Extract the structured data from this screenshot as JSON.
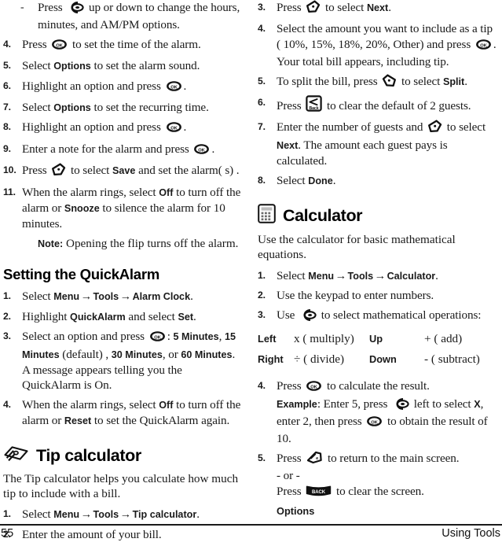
{
  "page": {
    "folio": "55",
    "running_head": "Using Tools"
  },
  "left_column": {
    "alarm_steps": [
      {
        "marker": "-",
        "type": "dash",
        "parts": [
          {
            "t": "Press "
          },
          {
            "icon": "nav-key-icon"
          },
          {
            "t": " up or down to change the hours, minutes, and AM/PM options."
          }
        ]
      },
      {
        "marker": "4.",
        "type": "num",
        "parts": [
          {
            "t": "Press "
          },
          {
            "icon": "ok-key-icon"
          },
          {
            "t": " to set the time of the alarm."
          }
        ]
      },
      {
        "marker": "5.",
        "type": "num",
        "parts": [
          {
            "t": "Select "
          },
          {
            "ui": "Options"
          },
          {
            "t": " to set the alarm sound."
          }
        ]
      },
      {
        "marker": "6.",
        "type": "num",
        "parts": [
          {
            "t": "Highlight an option and press "
          },
          {
            "icon": "ok-key-icon"
          },
          {
            "t": "."
          }
        ]
      },
      {
        "marker": "7.",
        "type": "num",
        "parts": [
          {
            "t": "Select "
          },
          {
            "ui": "Options"
          },
          {
            "t": " to set the recurring time."
          }
        ]
      },
      {
        "marker": "8.",
        "type": "num",
        "parts": [
          {
            "t": "Highlight an option and press "
          },
          {
            "icon": "ok-key-icon"
          },
          {
            "t": "."
          }
        ]
      },
      {
        "marker": "9.",
        "type": "num",
        "parts": [
          {
            "t": "Enter a note for the alarm and press "
          },
          {
            "icon": "ok-key-icon"
          },
          {
            "t": "."
          }
        ]
      },
      {
        "marker": "10.",
        "type": "num",
        "parts": [
          {
            "t": "Press "
          },
          {
            "icon": "right-softkey-icon"
          },
          {
            "t": " to select "
          },
          {
            "ui": "Save"
          },
          {
            "t": " and set the alarm( s) ."
          }
        ]
      },
      {
        "marker": "11.",
        "type": "num",
        "parts": [
          {
            "t": "When the alarm rings, select "
          },
          {
            "ui": "Off"
          },
          {
            "t": " to turn off the alarm or "
          },
          {
            "ui": "Snooze"
          },
          {
            "t": " to silence the alarm for 10 minutes."
          }
        ]
      }
    ],
    "note": {
      "label": "Note:",
      "text": "Opening the flip turns off the alarm."
    },
    "quickalarm_heading": "Setting the QuickAlarm",
    "quickalarm_steps": [
      {
        "marker": "1.",
        "parts": [
          {
            "t": "Select "
          },
          {
            "ui": "Menu"
          },
          {
            "arrow": "→"
          },
          {
            "ui": "Tools"
          },
          {
            "arrow": "→"
          },
          {
            "ui": "Alarm Clock"
          },
          {
            "t": "."
          }
        ]
      },
      {
        "marker": "2.",
        "parts": [
          {
            "t": "Highlight "
          },
          {
            "ui": "QuickAlarm"
          },
          {
            "t": " and select "
          },
          {
            "ui": "Set"
          },
          {
            "t": "."
          }
        ]
      },
      {
        "marker": "3.",
        "parts": [
          {
            "t": "Select an option and press "
          },
          {
            "icon": "ok-key-icon"
          },
          {
            "t": ": "
          },
          {
            "ui": "5 Minutes"
          },
          {
            "t": ", "
          },
          {
            "ui": "15 Minutes"
          },
          {
            "t": " (default) , "
          },
          {
            "ui": "30 Minutes"
          },
          {
            "t": ", or "
          },
          {
            "ui": "60 Minutes"
          },
          {
            "t": ". A message appears telling you the QuickAlarm is On."
          }
        ]
      },
      {
        "marker": "4.",
        "parts": [
          {
            "t": "When the alarm rings, select "
          },
          {
            "ui": "Off"
          },
          {
            "t": " to turn off the alarm or "
          },
          {
            "ui": "Reset"
          },
          {
            "t": " to set the QuickAlarm again."
          }
        ]
      }
    ],
    "tip_calculator": {
      "icon": "banknotes-icon",
      "heading": "Tip calculator",
      "intro": "The Tip calculator helps you calculate how much tip to include with a bill.",
      "steps": [
        {
          "marker": "1.",
          "parts": [
            {
              "t": "Select "
            },
            {
              "ui": "Menu"
            },
            {
              "arrow": "→"
            },
            {
              "ui": "Tools"
            },
            {
              "arrow": "→"
            },
            {
              "ui": "Tip calculator"
            },
            {
              "t": "."
            }
          ]
        },
        {
          "marker": "2.",
          "parts": [
            {
              "t": "Enter the amount of your bill."
            }
          ]
        }
      ]
    }
  },
  "right_column": {
    "tip_steps": [
      {
        "marker": "3.",
        "parts": [
          {
            "t": "Press "
          },
          {
            "icon": "right-softkey-icon"
          },
          {
            "t": " to select "
          },
          {
            "ui": "Next"
          },
          {
            "t": "."
          }
        ]
      },
      {
        "marker": "4.",
        "parts": [
          {
            "t": "Select the amount you want to include as a tip ( 10%, 15%, 18%, 20%, Other) and press "
          },
          {
            "icon": "ok-key-icon"
          },
          {
            "t": ". Your total bill appears, including tip."
          }
        ]
      },
      {
        "marker": "5.",
        "parts": [
          {
            "t": "To split the bill, press "
          },
          {
            "icon": "left-softkey-icon"
          },
          {
            "t": " to select "
          },
          {
            "ui": "Split"
          },
          {
            "t": "."
          }
        ]
      },
      {
        "marker": "6.",
        "parts": [
          {
            "t": "Press "
          },
          {
            "icon": "back-key-small-icon"
          },
          {
            "t": " to clear the default of 2 guests."
          }
        ]
      },
      {
        "marker": "7.",
        "parts": [
          {
            "t": "Enter the number of guests and "
          },
          {
            "icon": "right-softkey-icon"
          },
          {
            "t": " to select "
          },
          {
            "ui": "Next"
          },
          {
            "t": ". The amount each guest pays is calculated."
          }
        ]
      },
      {
        "marker": "8.",
        "parts": [
          {
            "t": "Select "
          },
          {
            "ui": "Done"
          },
          {
            "t": "."
          }
        ]
      }
    ],
    "calculator": {
      "icon": "calculator-icon",
      "heading": "Calculator",
      "intro": "Use the calculator for basic mathematical equations.",
      "steps_before": [
        {
          "marker": "1.",
          "parts": [
            {
              "t": "Select "
            },
            {
              "ui": "Menu"
            },
            {
              "arrow": "→"
            },
            {
              "ui": "Tools"
            },
            {
              "arrow": "→"
            },
            {
              "ui": "Calculator"
            },
            {
              "t": "."
            }
          ]
        },
        {
          "marker": "2.",
          "parts": [
            {
              "t": "Use the keypad to enter numbers."
            }
          ]
        },
        {
          "marker": "3.",
          "parts": [
            {
              "t": "Use "
            },
            {
              "icon": "nav-key-icon"
            },
            {
              "t": " to select mathematical operations:"
            }
          ]
        }
      ],
      "operations": [
        {
          "key1": "Left",
          "op1": "x ( multiply)",
          "key2": "Up",
          "op2": "+ ( add)"
        },
        {
          "key1": "Right",
          "op1": "÷ ( divide)",
          "key2": "Down",
          "op2": "- ( subtract)"
        }
      ],
      "steps_after": [
        {
          "marker": "4.",
          "parts": [
            {
              "t": "Press "
            },
            {
              "icon": "ok-key-icon"
            },
            {
              "t": " to calculate the result."
            },
            {
              "br": true
            },
            {
              "ui": "Example"
            },
            {
              "t": ": Enter 5, press "
            },
            {
              "icon": "nav-key-icon"
            },
            {
              "t": " left to select "
            },
            {
              "ui": "X"
            },
            {
              "t": ", enter 2, then press "
            },
            {
              "icon": "ok-key-icon"
            },
            {
              "t": " to obtain the result of 10."
            }
          ]
        },
        {
          "marker": "5.",
          "parts": [
            {
              "t": "Press "
            },
            {
              "icon": "end-key-icon"
            },
            {
              "t": " to return to the main screen."
            },
            {
              "br": true
            },
            {
              "t": "- or -"
            },
            {
              "br": true
            },
            {
              "t": "Press "
            },
            {
              "icon": "back-key-icon"
            },
            {
              "t": " to clear the screen."
            }
          ]
        }
      ],
      "options_label": "Options"
    }
  },
  "colors": {
    "text": "#1a1a1a",
    "rule": "#1a1a1a",
    "background": "#ffffff"
  }
}
